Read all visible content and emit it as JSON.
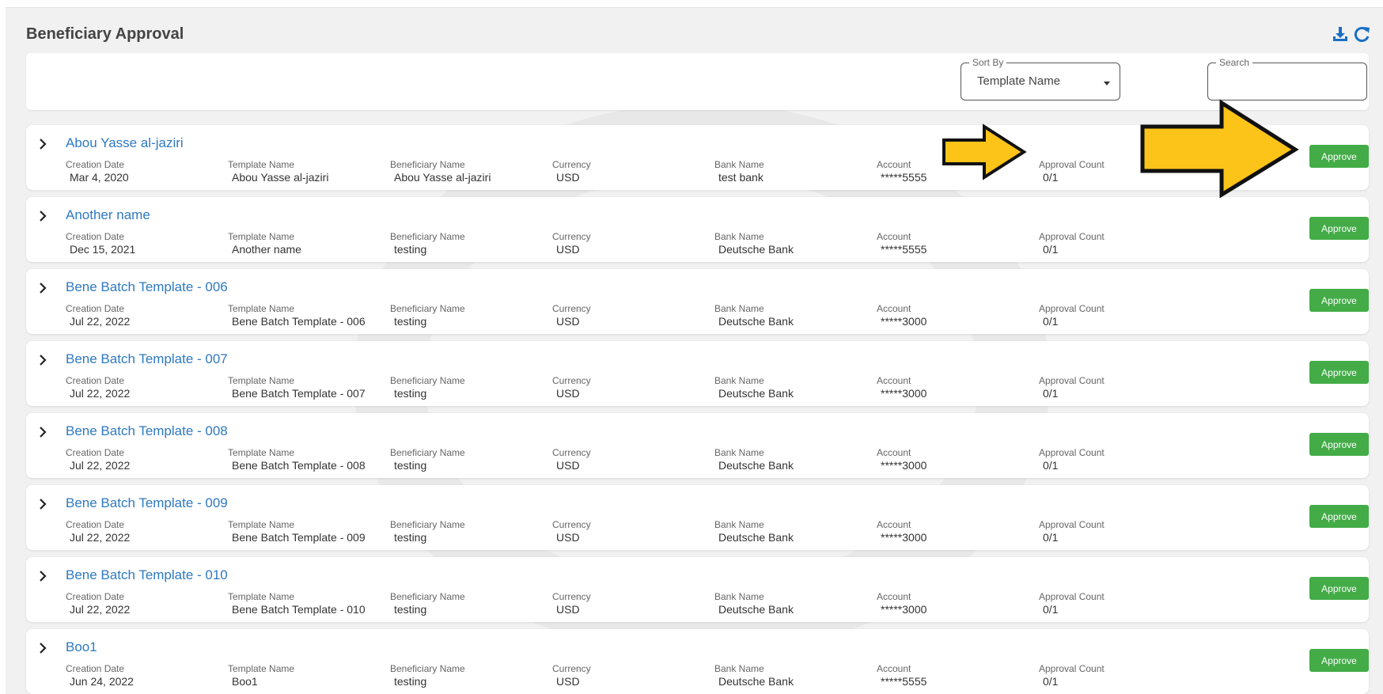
{
  "header": {
    "title": "Beneficiary Approval",
    "icons": [
      "download-icon",
      "refresh-icon"
    ]
  },
  "filters": {
    "sort_by": {
      "label": "Sort By",
      "value": "Template Name"
    },
    "search": {
      "label": "Search",
      "value": ""
    }
  },
  "columns": {
    "creation_date": "Creation Date",
    "template_name": "Template Name",
    "beneficiary_name": "Beneficiary Name",
    "currency": "Currency",
    "bank_name": "Bank Name",
    "account": "Account",
    "approval_count": "Approval Count"
  },
  "approve_label": "Approve",
  "rows": [
    {
      "title": "Abou Yasse al-jaziri",
      "creation_date": "Mar 4, 2020",
      "template_name": "Abou Yasse al-jaziri",
      "beneficiary_name": "Abou Yasse al-jaziri",
      "currency": "USD",
      "bank_name": "test bank",
      "account": "*****5555",
      "approval_count": "0/1"
    },
    {
      "title": "Another name",
      "creation_date": "Dec 15, 2021",
      "template_name": "Another name",
      "beneficiary_name": "testing",
      "currency": "USD",
      "bank_name": "Deutsche Bank",
      "account": "*****5555",
      "approval_count": "0/1"
    },
    {
      "title": "Bene Batch Template - 006",
      "creation_date": "Jul 22, 2022",
      "template_name": "Bene Batch Template - 006",
      "beneficiary_name": "testing",
      "currency": "USD",
      "bank_name": "Deutsche Bank",
      "account": "*****3000",
      "approval_count": "0/1"
    },
    {
      "title": "Bene Batch Template - 007",
      "creation_date": "Jul 22, 2022",
      "template_name": "Bene Batch Template - 007",
      "beneficiary_name": "testing",
      "currency": "USD",
      "bank_name": "Deutsche Bank",
      "account": "*****3000",
      "approval_count": "0/1"
    },
    {
      "title": "Bene Batch Template - 008",
      "creation_date": "Jul 22, 2022",
      "template_name": "Bene Batch Template - 008",
      "beneficiary_name": "testing",
      "currency": "USD",
      "bank_name": "Deutsche Bank",
      "account": "*****3000",
      "approval_count": "0/1"
    },
    {
      "title": "Bene Batch Template - 009",
      "creation_date": "Jul 22, 2022",
      "template_name": "Bene Batch Template - 009",
      "beneficiary_name": "testing",
      "currency": "USD",
      "bank_name": "Deutsche Bank",
      "account": "*****3000",
      "approval_count": "0/1"
    },
    {
      "title": "Bene Batch Template - 010",
      "creation_date": "Jul 22, 2022",
      "template_name": "Bene Batch Template - 010",
      "beneficiary_name": "testing",
      "currency": "USD",
      "bank_name": "Deutsche Bank",
      "account": "*****3000",
      "approval_count": "0/1"
    },
    {
      "title": "Boo1",
      "creation_date": "Jun 24, 2022",
      "template_name": "Boo1",
      "beneficiary_name": "testing",
      "currency": "USD",
      "bank_name": "Deutsche Bank",
      "account": "*****5555",
      "approval_count": "0/1"
    }
  ],
  "colors": {
    "link": "#2e79c2",
    "approve_button": "#43ac47",
    "icon_blue": "#1a6fc4",
    "annotation_arrow": "#fcc419"
  }
}
